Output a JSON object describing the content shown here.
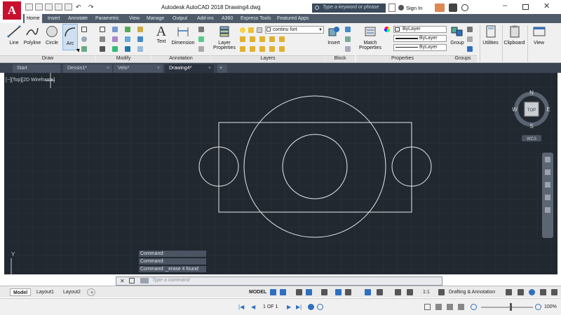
{
  "app": {
    "title": "Autodesk AutoCAD 2018    Drawing4.dwg",
    "search_placeholder": "Type a keyword or phrase",
    "sign_in": "Sign In"
  },
  "ribbon_tabs": [
    "Home",
    "Insert",
    "Annotate",
    "Parametric",
    "View",
    "Manage",
    "Output",
    "Add-ins",
    "A360",
    "Express Tools",
    "Featured Apps"
  ],
  "ribbon": {
    "draw": {
      "title": "Draw",
      "line": "Line",
      "polyline": "Polyline",
      "circle": "Circle",
      "arc": "Arc"
    },
    "modify": {
      "title": "Modify"
    },
    "annotation": {
      "title": "Annotation",
      "text": "Text",
      "dimension": "Dimension"
    },
    "layers": {
      "title": "Layers",
      "layer_properties_1": "Layer",
      "layer_properties_2": "Properties",
      "layer_name": "continu fort"
    },
    "block": {
      "title": "Block",
      "insert": "Insert"
    },
    "properties": {
      "title": "Properties",
      "match_1": "Match",
      "match_2": "Properties",
      "color": "ByLayer",
      "linetype": "ByLayer",
      "lineweight": "ByLayer"
    },
    "groups": {
      "title": "Groups",
      "group": "Group"
    },
    "utilities": "Utilities",
    "clipboard": "Clipboard",
    "view": "View"
  },
  "doc_tabs": [
    "Start",
    "Dessin1*",
    "Velo*",
    "Drawing4*"
  ],
  "viewport_label": "[−][Top][2D Wireframe]",
  "viewcube": {
    "n": "N",
    "s": "S",
    "e": "E",
    "w": "W",
    "top": "TOP",
    "wcs": "WCS"
  },
  "ucs": {
    "y": "Y",
    "x": "X"
  },
  "command_history": [
    "Command:",
    "Command:",
    "Command: _erase 4 found"
  ],
  "command_placeholder": "Type a command",
  "layout_tabs": [
    "Model",
    "Layout1",
    "Layout2"
  ],
  "status": {
    "model": "MODEL",
    "scale": "1:1",
    "workspace": "Drafting & Annotation"
  },
  "pager": {
    "page": "1 OF 1"
  },
  "zoom": "100%",
  "colors": {
    "canvas": "#212830",
    "ribbon_tabs": "#4f5b69",
    "accent": "#c8102e"
  }
}
